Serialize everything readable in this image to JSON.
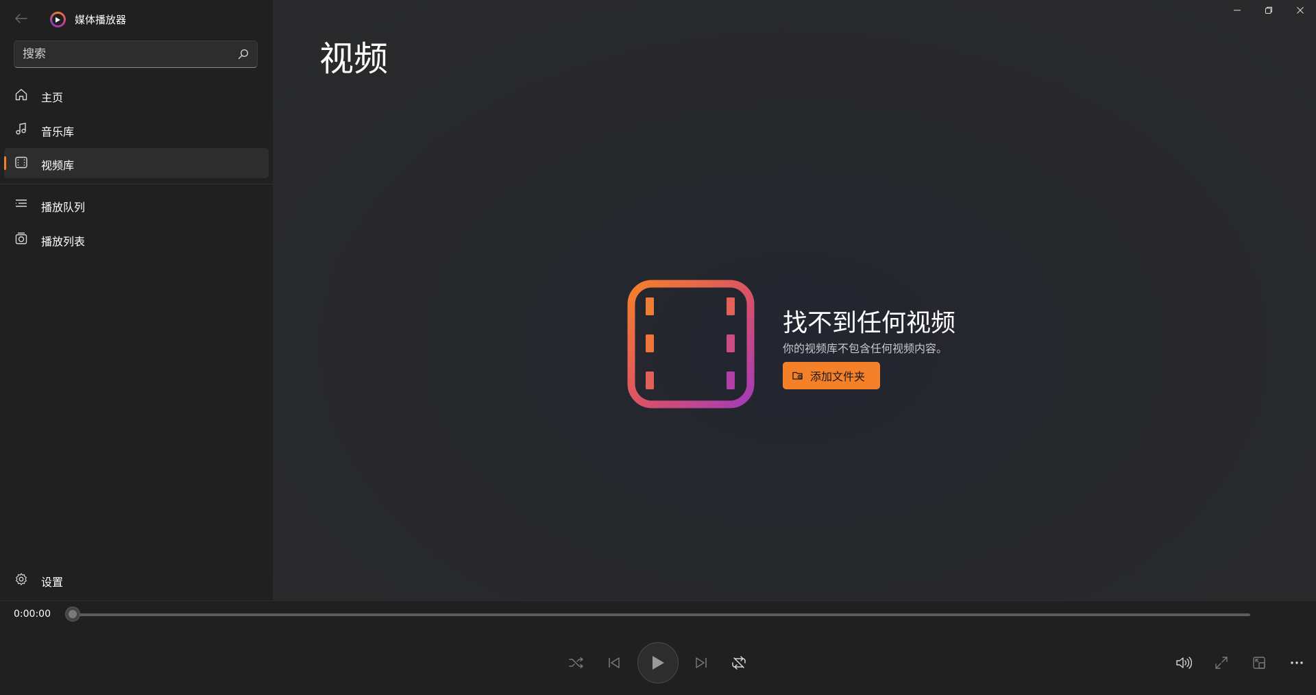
{
  "app": {
    "title": "媒体播放器",
    "icons": {
      "back": "back-arrow-icon",
      "logo": "media-player-logo-icon"
    }
  },
  "search": {
    "value": "",
    "placeholder": "搜索"
  },
  "sidebar": {
    "items": [
      {
        "label": "主页",
        "icon": "home-icon",
        "active": false
      },
      {
        "label": "音乐库",
        "icon": "music-note-icon",
        "active": false
      },
      {
        "label": "视频库",
        "icon": "film-icon",
        "active": true
      },
      {
        "label": "播放队列",
        "icon": "queue-list-icon",
        "active": false
      },
      {
        "label": "播放列表",
        "icon": "playlist-icon",
        "active": false
      }
    ],
    "settings": {
      "label": "设置",
      "icon": "gear-icon"
    }
  },
  "main": {
    "title": "视频",
    "empty_state": {
      "title": "找不到任何视频",
      "description": "你的视频库不包含任何视频内容。",
      "button_label": "添加文件夹",
      "icon": "film-strip-icon"
    }
  },
  "player": {
    "time": "0:00:00",
    "progress": 0.0,
    "controls": [
      "shuffle-icon",
      "previous-icon",
      "play-icon",
      "next-icon",
      "repeat-icon",
      "volume-icon",
      "fullscreen-icon",
      "mini-player-icon",
      "more-icon"
    ]
  },
  "colors": {
    "accent": "#f5802a",
    "gradient_pink": "#c23f8d",
    "gradient_purple": "#a43bb8",
    "sidebar_bg": "#202020",
    "main_bg": "#272729"
  }
}
